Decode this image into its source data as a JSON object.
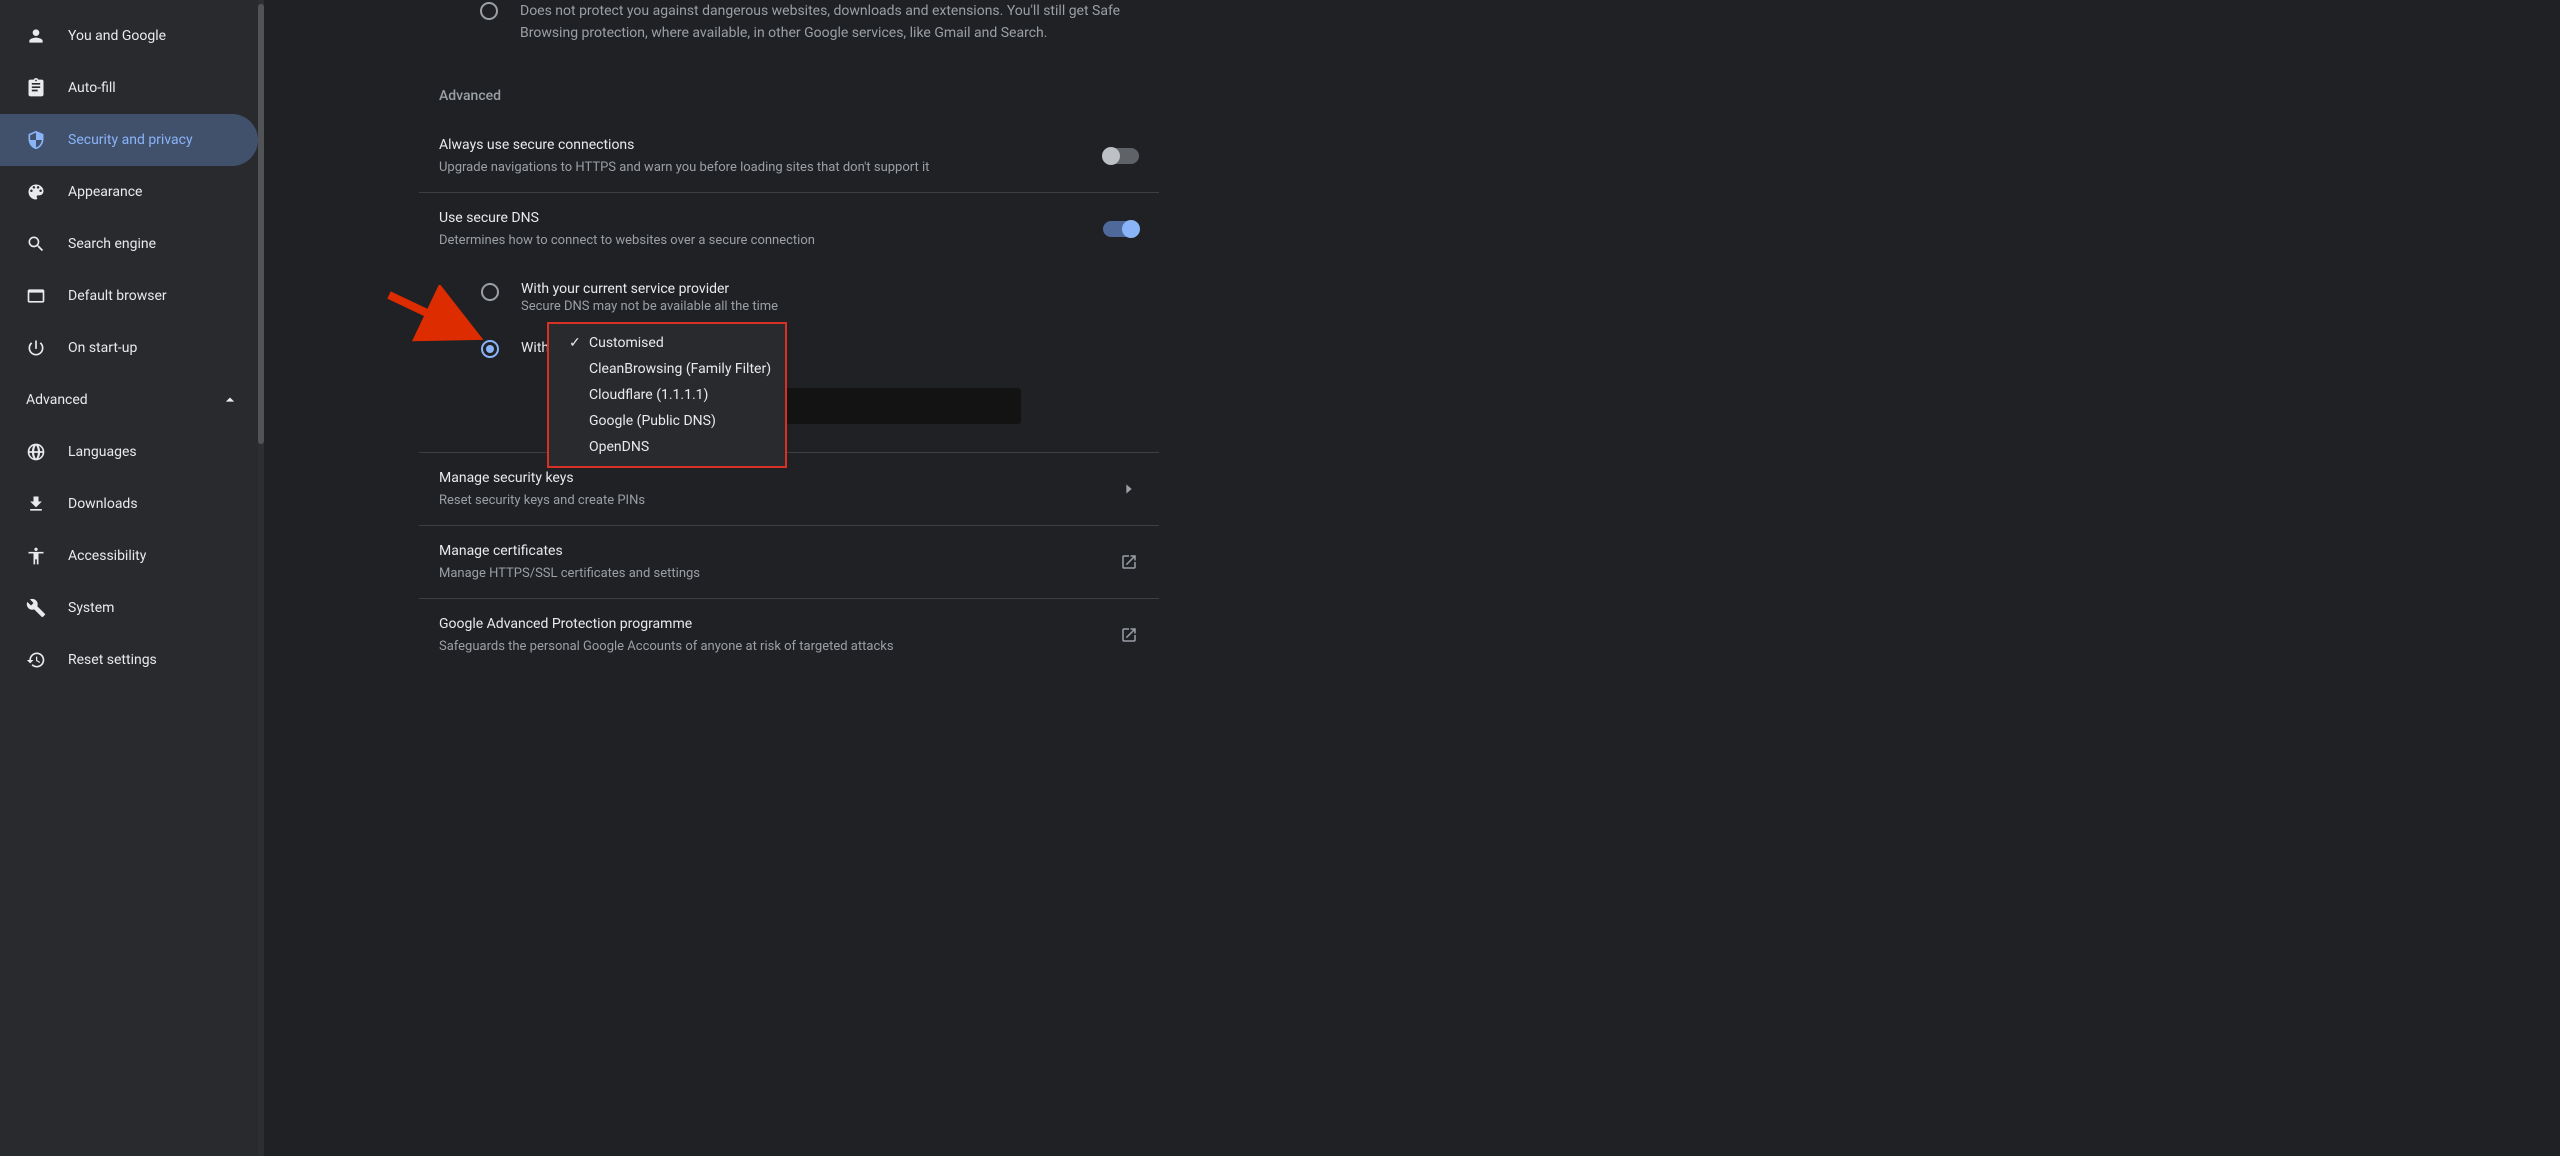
{
  "sidebar": {
    "items": [
      {
        "label": "You and Google"
      },
      {
        "label": "Auto-fill"
      },
      {
        "label": "Security and privacy"
      },
      {
        "label": "Appearance"
      },
      {
        "label": "Search engine"
      },
      {
        "label": "Default browser"
      },
      {
        "label": "On start-up"
      }
    ],
    "advanced_label": "Advanced",
    "advanced_items": [
      {
        "label": "Languages"
      },
      {
        "label": "Downloads"
      },
      {
        "label": "Accessibility"
      },
      {
        "label": "System"
      },
      {
        "label": "Reset settings"
      }
    ]
  },
  "main": {
    "truncated_desc": "Does not protect you against dangerous websites, downloads and extensions. You'll still get Safe Browsing protection, where available, in other Google services, like Gmail and Search.",
    "advanced_header": "Advanced",
    "secure_conn": {
      "title": "Always use secure connections",
      "desc": "Upgrade navigations to HTTPS and warn you before loading sites that don't support it"
    },
    "secure_dns": {
      "title": "Use secure DNS",
      "desc": "Determines how to connect to websites over a secure connection",
      "option_current": {
        "title": "With your current service provider",
        "desc": "Secure DNS may not be available all the time"
      },
      "option_with_label": "With",
      "dropdown": {
        "options": [
          "Customised",
          "CleanBrowsing (Family Filter)",
          "Cloudflare (1.1.1.1)",
          "Google (Public DNS)",
          "OpenDNS"
        ]
      }
    },
    "security_keys": {
      "title": "Manage security keys",
      "desc": "Reset security keys and create PINs"
    },
    "certificates": {
      "title": "Manage certificates",
      "desc": "Manage HTTPS/SSL certificates and settings"
    },
    "gapp": {
      "title": "Google Advanced Protection programme",
      "desc": "Safeguards the personal Google Accounts of anyone at risk of targeted attacks"
    }
  }
}
